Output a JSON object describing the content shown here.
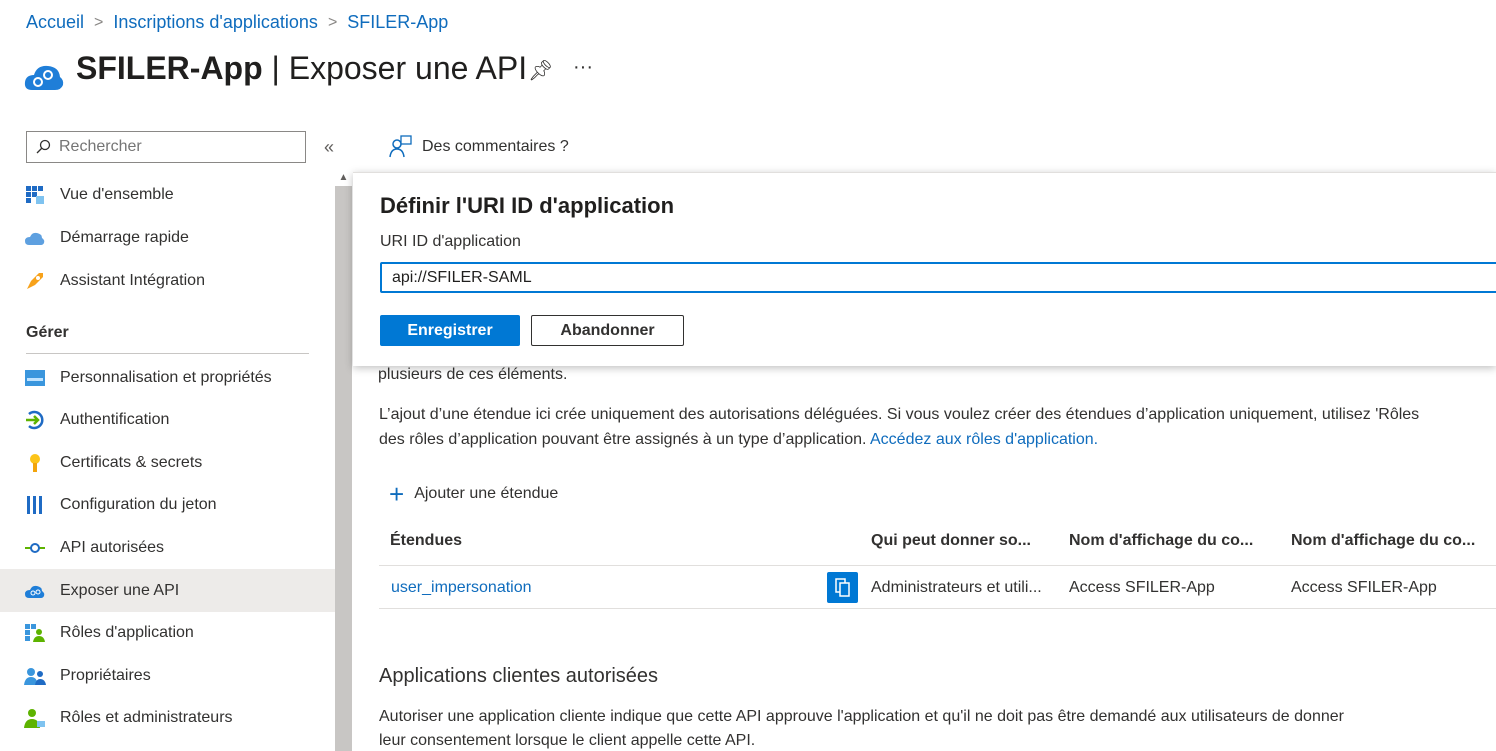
{
  "breadcrumb": [
    "Accueil",
    "Inscriptions d'applications",
    "SFILER-App"
  ],
  "header": {
    "app": "SFILER-App",
    "page": "Exposer une API",
    "separator": "|",
    "more": "···"
  },
  "sidebar": {
    "search_placeholder": "Rechercher",
    "collapse": "«",
    "items_top": [
      {
        "label": "Vue d'ensemble",
        "icon": "grid-icon"
      },
      {
        "label": "Démarrage rapide",
        "icon": "cloud-icon"
      },
      {
        "label": "Assistant Intégration",
        "icon": "rocket-icon"
      }
    ],
    "section": "Gérer",
    "items": [
      {
        "label": "Personnalisation et propriétés",
        "icon": "branding-icon"
      },
      {
        "label": "Authentification",
        "icon": "authentication-icon"
      },
      {
        "label": "Certificats & secrets",
        "icon": "key-icon"
      },
      {
        "label": "Configuration du jeton",
        "icon": "token-icon"
      },
      {
        "label": "API autorisées",
        "icon": "api-permissions-icon"
      },
      {
        "label": "Exposer une API",
        "icon": "expose-api-icon",
        "selected": true
      },
      {
        "label": "Rôles d'application",
        "icon": "app-roles-icon"
      },
      {
        "label": "Propriétaires",
        "icon": "owners-icon"
      },
      {
        "label": "Rôles et administrateurs",
        "icon": "roles-admins-icon"
      }
    ]
  },
  "toolbar": {
    "feedback": "Des commentaires ?"
  },
  "modal": {
    "title": "Définir l'URI ID d'application",
    "label": "URI ID d'application",
    "value": "api://SFILER-SAML",
    "save": "Enregistrer",
    "cancel": "Abandonner"
  },
  "main": {
    "partial_text": "plusieurs de ces éléments.",
    "para1": "L’ajout d’une étendue ici crée uniquement des autorisations déléguées. Si vous voulez créer des étendues d’application uniquement, utilisez 'Rôles",
    "para2": "des rôles d’application pouvant être assignés à un type d’application.",
    "para2_link": "Accédez aux rôles d'application.",
    "add_scope": "Ajouter une étendue",
    "table": {
      "headers": [
        "Étendues",
        "Qui peut donner so...",
        "Nom d'affichage du co...",
        "Nom d'affichage du co..."
      ],
      "rows": [
        [
          "user_impersonation",
          "Administrateurs et utili...",
          "Access SFILER-App",
          "Access SFILER-App"
        ]
      ]
    },
    "clients_title": "Applications clientes autorisées",
    "clients_p1": "Autoriser une application cliente indique que cette API approuve l'application et qu'il ne doit pas être demandé aux utilisateurs de donner",
    "clients_p2": "leur consentement lorsque le client appelle cette API."
  },
  "colors": {
    "accent": "#0078d4",
    "link": "#0f6cbd"
  }
}
